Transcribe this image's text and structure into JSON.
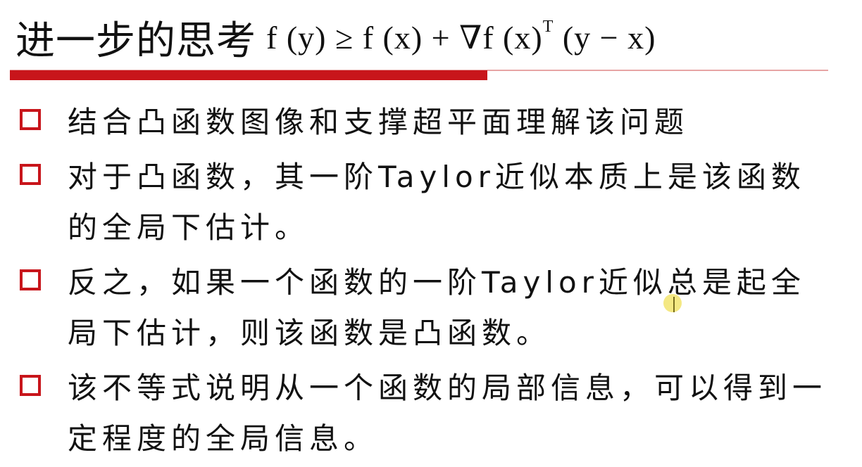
{
  "slide": {
    "title": "进一步的思考",
    "formula": {
      "lhs": "f (y) ≥ f (x) + ∇f (x)",
      "superscript": "T",
      "rhs": " (y − x)"
    },
    "bullets": [
      "结合凸函数图像和支撑超平面理解该问题",
      "对于凸函数，其一阶Taylor近似本质上是该函数的全局下估计。",
      "反之，如果一个函数的一阶Taylor近似总是起全局下估计，则该函数是凸函数。",
      "该不等式说明从一个函数的局部信息，可以得到一定程度的全局信息。"
    ]
  },
  "colors": {
    "accent_red": "#c8151b",
    "rule_light": "#e7a5a5",
    "text": "#111111"
  },
  "icons": {
    "bullet": "hollow-square-icon",
    "cursor": "text-cursor-icon"
  }
}
